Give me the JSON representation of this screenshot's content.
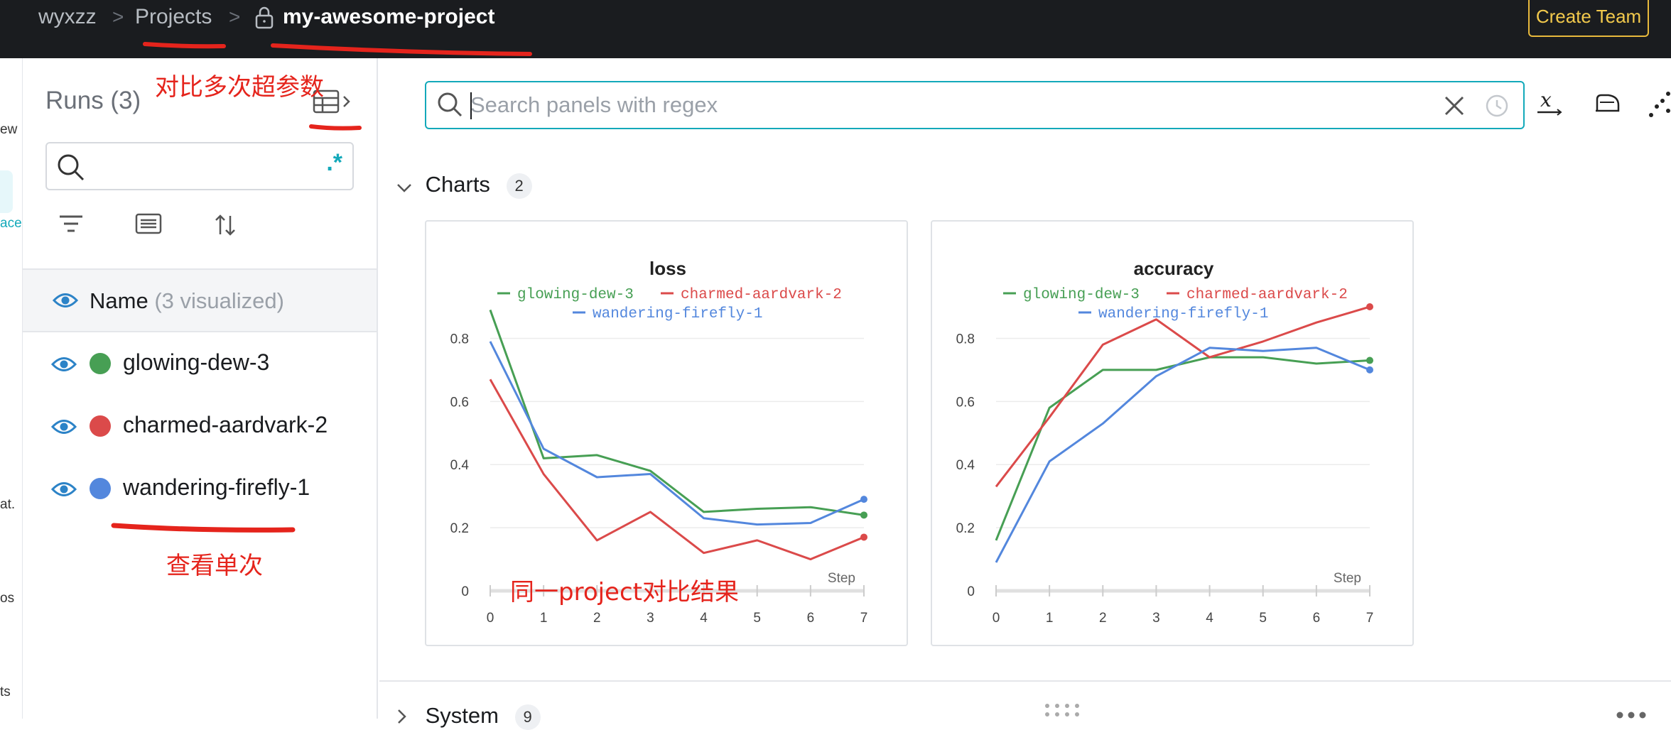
{
  "breadcrumb": {
    "entity": "wyxzz",
    "projects": "Projects",
    "project_name": "my-awesome-project",
    "separator": ">"
  },
  "header": {
    "create_team_label": "Create Team"
  },
  "left_nav": {
    "fragments": [
      "ew",
      "ace",
      "at.",
      "os",
      "ts"
    ]
  },
  "runs": {
    "title": "Runs (3)",
    "search_value": "",
    "regex_label": ".*",
    "name_header": "Name",
    "visualized_label": "(3 visualized)",
    "items": [
      {
        "name": "glowing-dew-3",
        "color": "#479f54"
      },
      {
        "name": "charmed-aardvark-2",
        "color": "#db4a4a"
      },
      {
        "name": "wandering-firefly-1",
        "color": "#5387dd"
      }
    ]
  },
  "annotations": {
    "compare_hparams": "对比多次超参数",
    "view_single": "查看单次",
    "compare_results": "同一project对比结果"
  },
  "panel_search": {
    "placeholder": "Search panels with regex"
  },
  "sections": {
    "charts": {
      "label": "Charts",
      "count": "2"
    },
    "system": {
      "label": "System",
      "count": "9"
    }
  },
  "chart_data": [
    {
      "type": "line",
      "title": "loss",
      "xlabel": "Step",
      "ylabel": "",
      "x": [
        0,
        1,
        2,
        3,
        4,
        5,
        6,
        7
      ],
      "xlim": [
        0,
        7
      ],
      "ylim": [
        0,
        0.9
      ],
      "yticks": [
        0,
        0.2,
        0.4,
        0.6,
        0.8
      ],
      "legend_position": "top",
      "grid": true,
      "series": [
        {
          "name": "glowing-dew-3",
          "color": "#479f54",
          "values": [
            0.89,
            0.42,
            0.43,
            0.38,
            0.25,
            0.26,
            0.265,
            0.24
          ]
        },
        {
          "name": "charmed-aardvark-2",
          "color": "#db4a4a",
          "values": [
            0.67,
            0.37,
            0.16,
            0.25,
            0.12,
            0.16,
            0.1,
            0.17
          ]
        },
        {
          "name": "wandering-firefly-1",
          "color": "#5387dd",
          "values": [
            0.79,
            0.45,
            0.36,
            0.37,
            0.23,
            0.21,
            0.215,
            0.29
          ]
        }
      ]
    },
    {
      "type": "line",
      "title": "accuracy",
      "xlabel": "Step",
      "ylabel": "",
      "x": [
        0,
        1,
        2,
        3,
        4,
        5,
        6,
        7
      ],
      "xlim": [
        0,
        7
      ],
      "ylim": [
        0,
        0.9
      ],
      "yticks": [
        0,
        0.2,
        0.4,
        0.6,
        0.8
      ],
      "legend_position": "top",
      "grid": true,
      "series": [
        {
          "name": "glowing-dew-3",
          "color": "#479f54",
          "values": [
            0.16,
            0.58,
            0.7,
            0.7,
            0.74,
            0.74,
            0.72,
            0.73
          ]
        },
        {
          "name": "charmed-aardvark-2",
          "color": "#db4a4a",
          "values": [
            0.33,
            0.55,
            0.78,
            0.86,
            0.74,
            0.79,
            0.85,
            0.9
          ]
        },
        {
          "name": "wandering-firefly-1",
          "color": "#5387dd",
          "values": [
            0.09,
            0.41,
            0.53,
            0.68,
            0.77,
            0.76,
            0.77,
            0.7
          ]
        }
      ]
    }
  ]
}
